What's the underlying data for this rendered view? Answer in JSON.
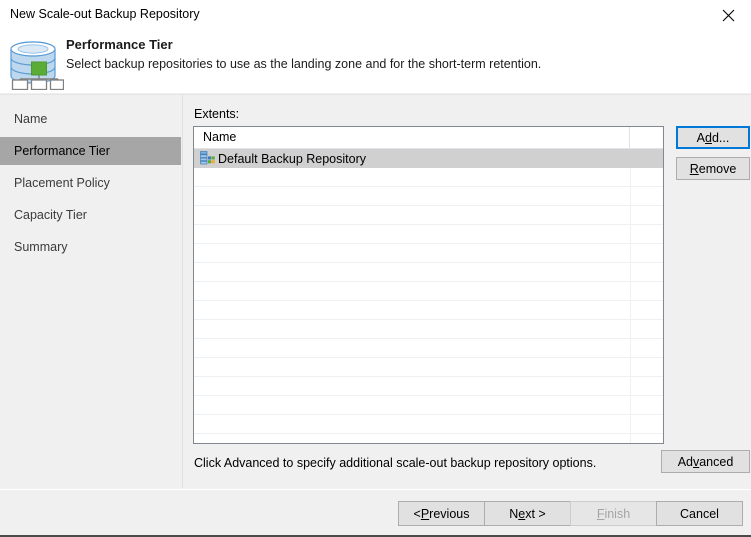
{
  "window": {
    "title": "New Scale-out Backup Repository",
    "close_icon": "close-icon"
  },
  "header": {
    "icon": "scale-out-repository-icon",
    "title": "Performance Tier",
    "subtitle": "Select backup repositories to use as the landing zone and for the short-term retention."
  },
  "sidebar": {
    "items": [
      {
        "label": "Name",
        "selected": false
      },
      {
        "label": "Performance Tier",
        "selected": true
      },
      {
        "label": "Placement Policy",
        "selected": false
      },
      {
        "label": "Capacity Tier",
        "selected": false
      },
      {
        "label": "Summary",
        "selected": false
      }
    ]
  },
  "main": {
    "extents_label": "Extents:",
    "columns": [
      "Name"
    ],
    "rows": [
      {
        "icon": "backup-repository-icon",
        "name": "Default Backup Repository",
        "selected": true
      }
    ],
    "empty_row_count": 14,
    "add_label_pre": "A",
    "add_label_mnemonic": "d",
    "add_label_post": "d...",
    "remove_label_mnemonic": "R",
    "remove_label_post": "emove",
    "hint": "Click Advanced to specify additional scale-out backup repository options.",
    "advanced_pre": "Ad",
    "advanced_mnemonic": "v",
    "advanced_post": "anced"
  },
  "footer": {
    "previous_pre": "< ",
    "previous_mnemonic": "P",
    "previous_post": "revious",
    "next_pre": "N",
    "next_mnemonic": "e",
    "next_post": "xt >",
    "finish_mnemonic": "F",
    "finish_post": "inish",
    "cancel_label": "Cancel"
  },
  "colors": {
    "accent": "#0078d7",
    "selection": "#d0d0d0",
    "nav_selection": "#a6a6a6",
    "window_bg": "#f0f0f0",
    "field_bg": "#ffffff"
  }
}
